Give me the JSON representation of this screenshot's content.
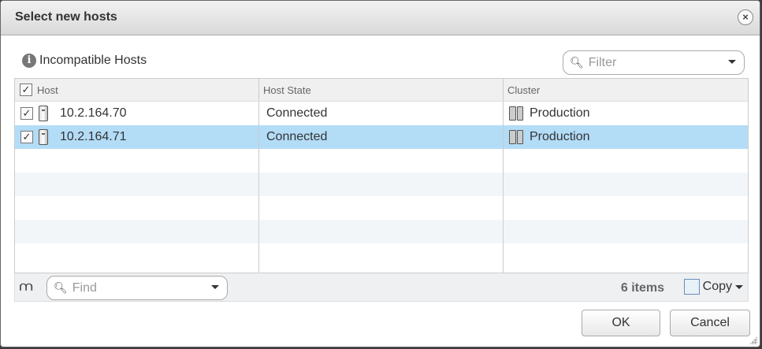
{
  "dialog": {
    "title": "Select new hosts"
  },
  "incompatible_label": "Incompatible Hosts",
  "filter": {
    "placeholder": "Filter"
  },
  "grid": {
    "columns": [
      "Host",
      "Host State",
      "Cluster"
    ],
    "rows": [
      {
        "host": "10.2.164.70",
        "state": "Connected",
        "cluster": "Production",
        "checked": true,
        "selected": false
      },
      {
        "host": "10.2.164.71",
        "state": "Connected",
        "cluster": "Production",
        "checked": true,
        "selected": true
      }
    ]
  },
  "footer": {
    "find_placeholder": "Find",
    "items": "6 items",
    "copy": "Copy"
  },
  "buttons": {
    "ok": "OK",
    "cancel": "Cancel"
  }
}
